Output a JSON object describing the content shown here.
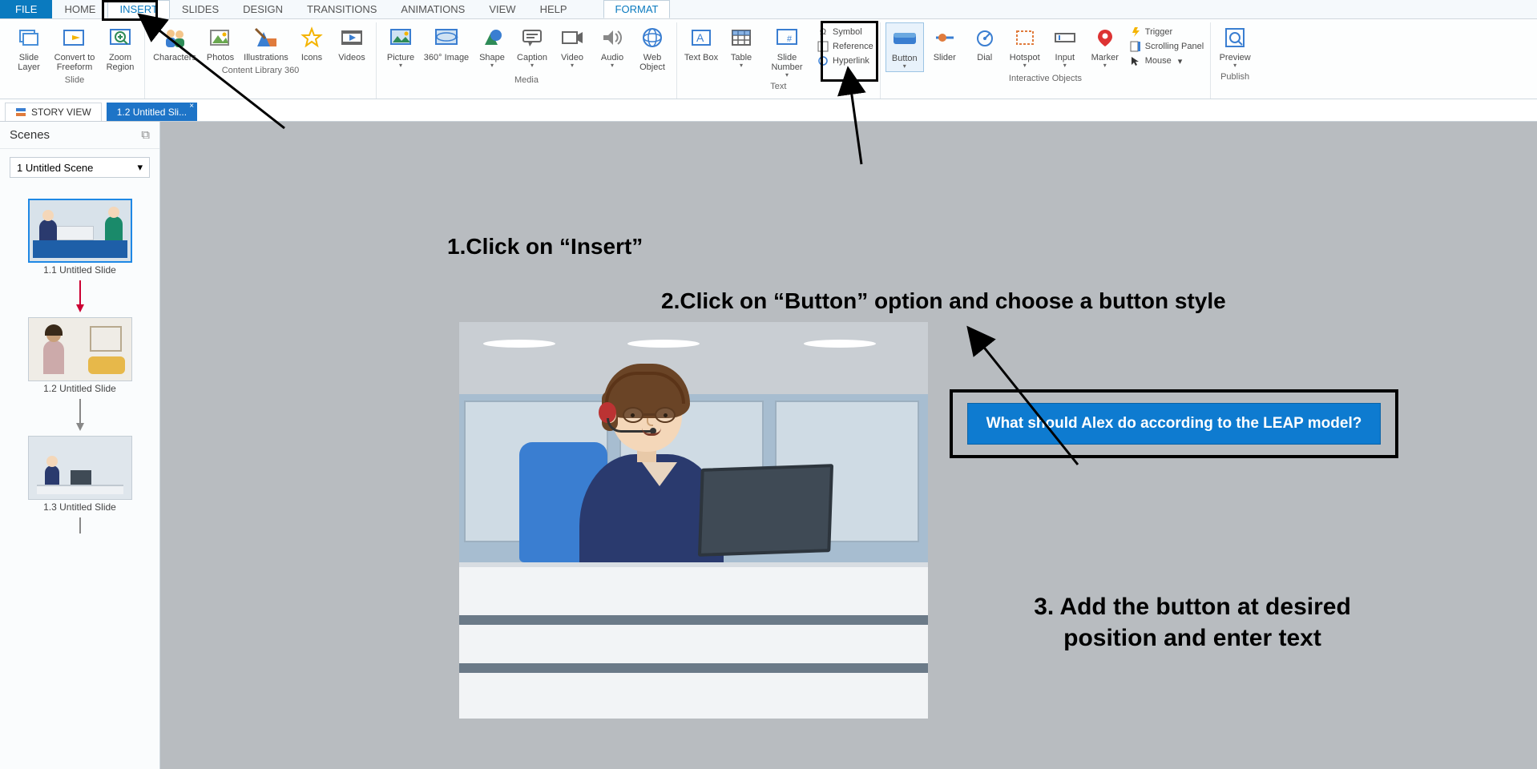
{
  "menu": {
    "file": "FILE",
    "home": "HOME",
    "insert": "INSERT",
    "slides": "SLIDES",
    "design": "DESIGN",
    "transitions": "TRANSITIONS",
    "animations": "ANIMATIONS",
    "view": "VIEW",
    "help": "HELP",
    "format": "FORMAT"
  },
  "ribbon": {
    "slide_layer": "Slide Layer",
    "convert_freeform": "Convert to Freeform",
    "zoom_region": "Zoom Region",
    "group_slide": "Slide",
    "characters": "Characters",
    "photos": "Photos",
    "illustrations": "Illustrations",
    "icons": "Icons",
    "videos": "Videos",
    "group_content": "Content Library 360",
    "picture": "Picture",
    "image360": "360° Image",
    "shape": "Shape",
    "caption": "Caption",
    "video": "Video",
    "audio": "Audio",
    "web_object": "Web Object",
    "group_media": "Media",
    "text_box": "Text Box",
    "table": "Table",
    "slide_number": "Slide Number",
    "symbol": "Symbol",
    "reference": "Reference",
    "hyperlink": "Hyperlink",
    "group_text": "Text",
    "button": "Button",
    "slider": "Slider",
    "dial": "Dial",
    "hotspot": "Hotspot",
    "input": "Input",
    "marker": "Marker",
    "trigger": "Trigger",
    "scrolling_panel": "Scrolling Panel",
    "mouse": "Mouse",
    "group_interactive": "Interactive Objects",
    "preview": "Preview",
    "group_publish": "Publish"
  },
  "doc_tabs": {
    "story_view": "STORY VIEW",
    "slide_tab": "1.2 Untitled Sli..."
  },
  "side": {
    "title": "Scenes",
    "scene_selected": "1 Untitled Scene",
    "thumb1": "1.1 Untitled Slide",
    "thumb2": "1.2 Untitled Slide",
    "thumb3": "1.3 Untitled Slide"
  },
  "slide": {
    "button_text": "What should Alex do according to the LEAP model?"
  },
  "annotations": {
    "a1": "1.Click on “Insert”",
    "a2": "2.Click on “Button” option and choose a button style",
    "a3": "3. Add the button at desired position and enter text"
  }
}
